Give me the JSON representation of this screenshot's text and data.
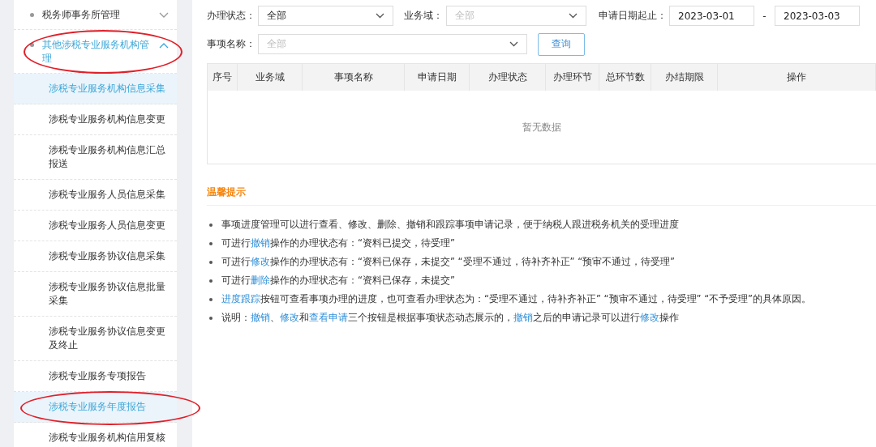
{
  "sidebar": {
    "items": [
      {
        "label": "税务师事务所管理",
        "expanded": false,
        "circled": false
      },
      {
        "label": "其他涉税专业服务机构管理",
        "expanded": true,
        "circled": true,
        "children": [
          {
            "label": "涉税专业服务机构信息采集",
            "selected": true,
            "circled": false
          },
          {
            "label": "涉税专业服务机构信息变更",
            "selected": false,
            "circled": false
          },
          {
            "label": "涉税专业服务机构信息汇总报送",
            "selected": false,
            "circled": false
          },
          {
            "label": "涉税专业服务人员信息采集",
            "selected": false,
            "circled": false
          },
          {
            "label": "涉税专业服务人员信息变更",
            "selected": false,
            "circled": false
          },
          {
            "label": "涉税专业服务协议信息采集",
            "selected": false,
            "circled": false
          },
          {
            "label": "涉税专业服务协议信息批量采集",
            "selected": false,
            "circled": false
          },
          {
            "label": "涉税专业服务协议信息变更及终止",
            "selected": false,
            "circled": false
          },
          {
            "label": "涉税专业服务专项报告",
            "selected": false,
            "circled": false
          },
          {
            "label": "涉税专业服务年度报告",
            "selected": true,
            "circled": true
          },
          {
            "label": "涉税专业服务机构信用复核",
            "selected": false,
            "circled": false
          }
        ]
      }
    ]
  },
  "filters": {
    "status": {
      "label": "办理状态：",
      "value": "全部"
    },
    "domain": {
      "label": "业务域：",
      "placeholder": "全部"
    },
    "date_range": {
      "label": "申请日期起止：",
      "start": "2023-03-01",
      "separator": "-",
      "end": "2023-03-03"
    },
    "item_name": {
      "label": "事项名称：",
      "placeholder": "全部"
    },
    "query_button": "查询"
  },
  "table": {
    "columns": [
      "序号",
      "业务域",
      "事项名称",
      "申请日期",
      "办理状态",
      "办理环节",
      "总环节数",
      "办结期限",
      "操作"
    ],
    "empty_text": "暂无数据"
  },
  "tips": {
    "title": "温馨提示",
    "items": [
      [
        {
          "text": "事项进度管理可以进行查看、修改、删除、撤销和跟踪事项申请记录，便于纳税人跟进税务机关的受理进度",
          "link": false
        }
      ],
      [
        {
          "text": "可进行",
          "link": false
        },
        {
          "text": "撤销",
          "link": true
        },
        {
          "text": "操作的办理状态有：“资料已提交，待受理”",
          "link": false
        }
      ],
      [
        {
          "text": "可进行",
          "link": false
        },
        {
          "text": "修改",
          "link": true
        },
        {
          "text": "操作的办理状态有：“资料已保存，未提交”  “受理不通过，待补齐补正”  “预审不通过，待受理”",
          "link": false
        }
      ],
      [
        {
          "text": "可进行",
          "link": false
        },
        {
          "text": "删除",
          "link": true
        },
        {
          "text": "操作的办理状态有：“资料已保存，未提交”",
          "link": false
        }
      ],
      [
        {
          "text": "进度跟踪",
          "link": true
        },
        {
          "text": "按钮可查看事项办理的进度，也可查看办理状态为：“受理不通过，待补齐补正”  “预审不通过，待受理”  “不予受理”的具体原因。",
          "link": false
        }
      ],
      [
        {
          "text": "说明：",
          "link": false
        },
        {
          "text": "撤销",
          "link": true
        },
        {
          "text": "、",
          "link": false
        },
        {
          "text": "修改",
          "link": true
        },
        {
          "text": "和",
          "link": false
        },
        {
          "text": "查看申请",
          "link": true
        },
        {
          "text": "三个按钮是根据事项状态动态展示的，",
          "link": false
        },
        {
          "text": "撤销",
          "link": true
        },
        {
          "text": "之后的申请记录可以进行",
          "link": false
        },
        {
          "text": "修改",
          "link": true
        },
        {
          "text": "操作",
          "link": false
        }
      ]
    ]
  }
}
